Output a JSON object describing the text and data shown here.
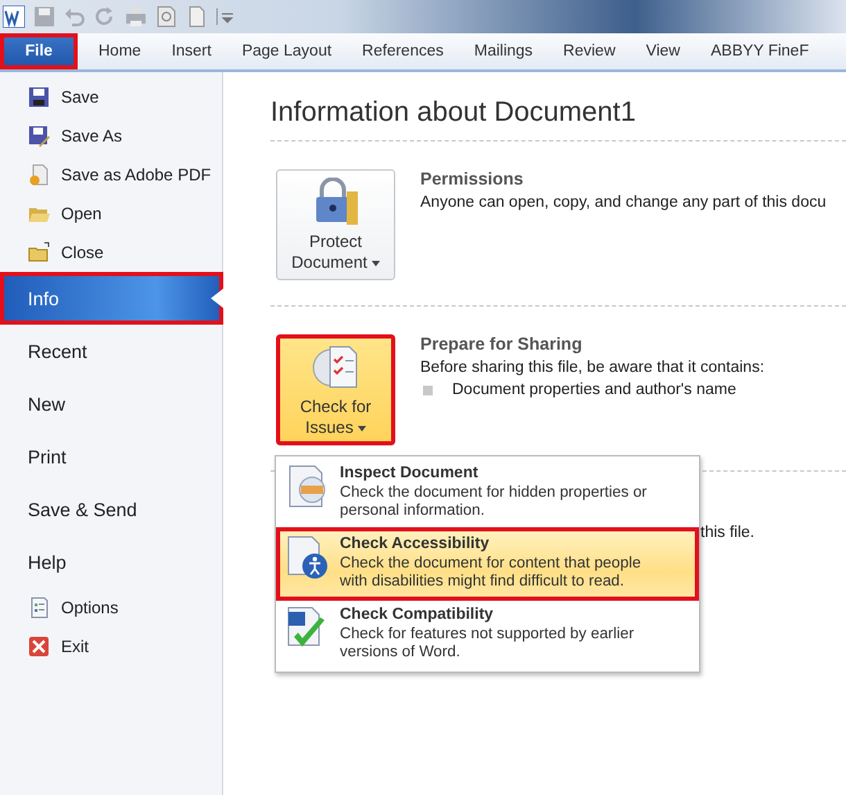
{
  "tabs": [
    {
      "label": "File",
      "selected": true,
      "highlighted": true
    },
    {
      "label": "Home",
      "selected": false,
      "highlighted": false
    },
    {
      "label": "Insert",
      "selected": false,
      "highlighted": false
    },
    {
      "label": "Page Layout",
      "selected": false,
      "highlighted": false
    },
    {
      "label": "References",
      "selected": false,
      "highlighted": false
    },
    {
      "label": "Mailings",
      "selected": false,
      "highlighted": false
    },
    {
      "label": "Review",
      "selected": false,
      "highlighted": false
    },
    {
      "label": "View",
      "selected": false,
      "highlighted": false
    },
    {
      "label": "ABBYY FineF",
      "selected": false,
      "highlighted": false
    }
  ],
  "sidebar": {
    "items": [
      {
        "label": "Save",
        "kind": "command",
        "selected": false,
        "highlighted": false
      },
      {
        "label": "Save As",
        "kind": "command",
        "selected": false,
        "highlighted": false
      },
      {
        "label": "Save as Adobe PDF",
        "kind": "command",
        "selected": false,
        "highlighted": false
      },
      {
        "label": "Open",
        "kind": "command",
        "selected": false,
        "highlighted": false
      },
      {
        "label": "Close",
        "kind": "command",
        "selected": false,
        "highlighted": false
      },
      {
        "label": "Info",
        "kind": "page",
        "selected": true,
        "highlighted": true
      },
      {
        "label": "Recent",
        "kind": "page",
        "selected": false,
        "highlighted": false
      },
      {
        "label": "New",
        "kind": "page",
        "selected": false,
        "highlighted": false
      },
      {
        "label": "Print",
        "kind": "page",
        "selected": false,
        "highlighted": false
      },
      {
        "label": "Save & Send",
        "kind": "page",
        "selected": false,
        "highlighted": false
      },
      {
        "label": "Help",
        "kind": "page",
        "selected": false,
        "highlighted": false
      },
      {
        "label": "Options",
        "kind": "command",
        "selected": false,
        "highlighted": false
      },
      {
        "label": "Exit",
        "kind": "command",
        "selected": false,
        "highlighted": false
      }
    ]
  },
  "main": {
    "title": "Information about Document1",
    "sections": [
      {
        "heading": "Permissions",
        "text": "Anyone can open, copy, and change any part of this docu",
        "button": {
          "label": "Protect Document",
          "highlighted": false
        }
      },
      {
        "heading": "Prepare for Sharing",
        "text": "Before sharing this file, be aware that it contains:",
        "bullets": [
          "Document properties and author's name"
        ],
        "button": {
          "label": "Check for Issues",
          "highlighted": true
        }
      },
      {
        "text": "this file."
      }
    ]
  },
  "dropdown": {
    "items": [
      {
        "title": "Inspect Document",
        "description": "Check the document for hidden properties or personal information.",
        "selected": false,
        "highlighted": false
      },
      {
        "title": "Check Accessibility",
        "description": "Check the document for content that people with disabilities might find difficult to read.",
        "selected": true,
        "highlighted": true
      },
      {
        "title": "Check Compatibility",
        "description": "Check for features not supported by earlier versions of Word.",
        "selected": false,
        "highlighted": false
      }
    ]
  }
}
